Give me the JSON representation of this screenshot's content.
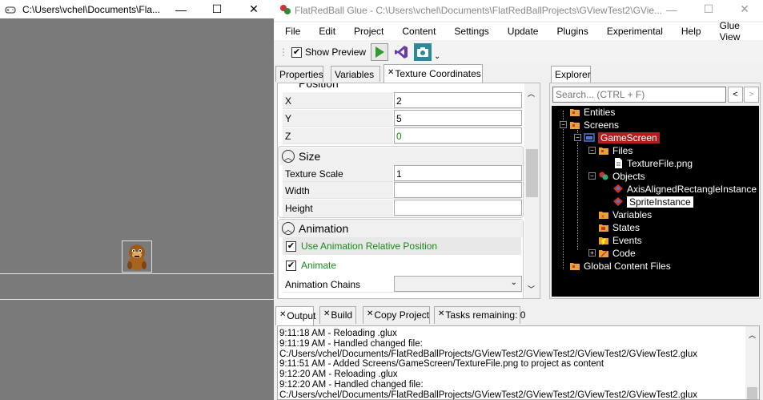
{
  "game_window": {
    "title": "C:\\Users\\vchel\\Documents\\Fla...",
    "minimize": "—",
    "maximize": "☐",
    "close": "✕"
  },
  "glue_window": {
    "title": "FlatRedBall Glue - C:\\Users\\vchel\\Documents\\FlatRedBallProjects\\GViewTest2\\GVie...",
    "minimize": "—",
    "maximize": "☐",
    "close": "✕"
  },
  "menu": [
    "File",
    "Edit",
    "Project",
    "Content",
    "Settings",
    "Update",
    "Plugins",
    "Experimental",
    "Help",
    "Glue View"
  ],
  "toolbar": {
    "show_preview_label": "Show Preview",
    "show_preview_checked": true,
    "overflow": "⌄"
  },
  "left_tabs": {
    "properties": "Properties",
    "variables": "Variables",
    "texture_coordinates": "Texture Coordinates",
    "close_glyph": "✕"
  },
  "properties": {
    "position_partial": "Position",
    "x_label": "X",
    "x_value": "2",
    "y_label": "Y",
    "y_value": "5",
    "z_label": "Z",
    "z_value": "0",
    "size_header": "Size",
    "texture_scale_label": "Texture Scale",
    "texture_scale_value": "1",
    "width_label": "Width",
    "width_value": "",
    "height_label": "Height",
    "height_value": "",
    "animation_header": "Animation",
    "use_anim_rel_pos_label": "Use Animation Relative Position",
    "use_anim_rel_pos_checked": true,
    "animate_label": "Animate",
    "animate_checked": true,
    "animation_chains_label": "Animation Chains",
    "animation_chains_value": ""
  },
  "explorer": {
    "tab_label": "Explorer",
    "search_placeholder": "Search... (CTRL + F)",
    "back": "<",
    "forward": ">",
    "tree": {
      "entities": "Entities",
      "screens": "Screens",
      "game_screen": "GameScreen",
      "files": "Files",
      "texture_file": "TextureFile.png",
      "objects": "Objects",
      "axis_rect": "AxisAlignedRectangleInstance",
      "sprite_instance": "SpriteInstance",
      "variables": "Variables",
      "states": "States",
      "events": "Events",
      "code": "Code",
      "global_content": "Global Content Files"
    }
  },
  "bottom_tabs": {
    "output": "Output",
    "build": "Build",
    "copy_project": "Copy Project",
    "tasks": "Tasks remaining: 0"
  },
  "output_log": [
    "9:11:18 AM - Reloading .glux",
    "9:11:19 AM - Handled changed file:",
    "C:/Users/vchel/Documents/FlatRedBallProjects/GViewTest2/GViewTest2/GViewTest2/GViewTest2.glux",
    "9:11:51 AM - Added Screens/GameScreen/TextureFile.png to project as content",
    "9:12:20 AM - Reloading .glux",
    "9:12:20 AM - Handled changed file:",
    "C:/Users/vchel/Documents/FlatRedBallProjects/GViewTest2/GViewTest2/GViewTest2/GViewTest2.glux"
  ]
}
